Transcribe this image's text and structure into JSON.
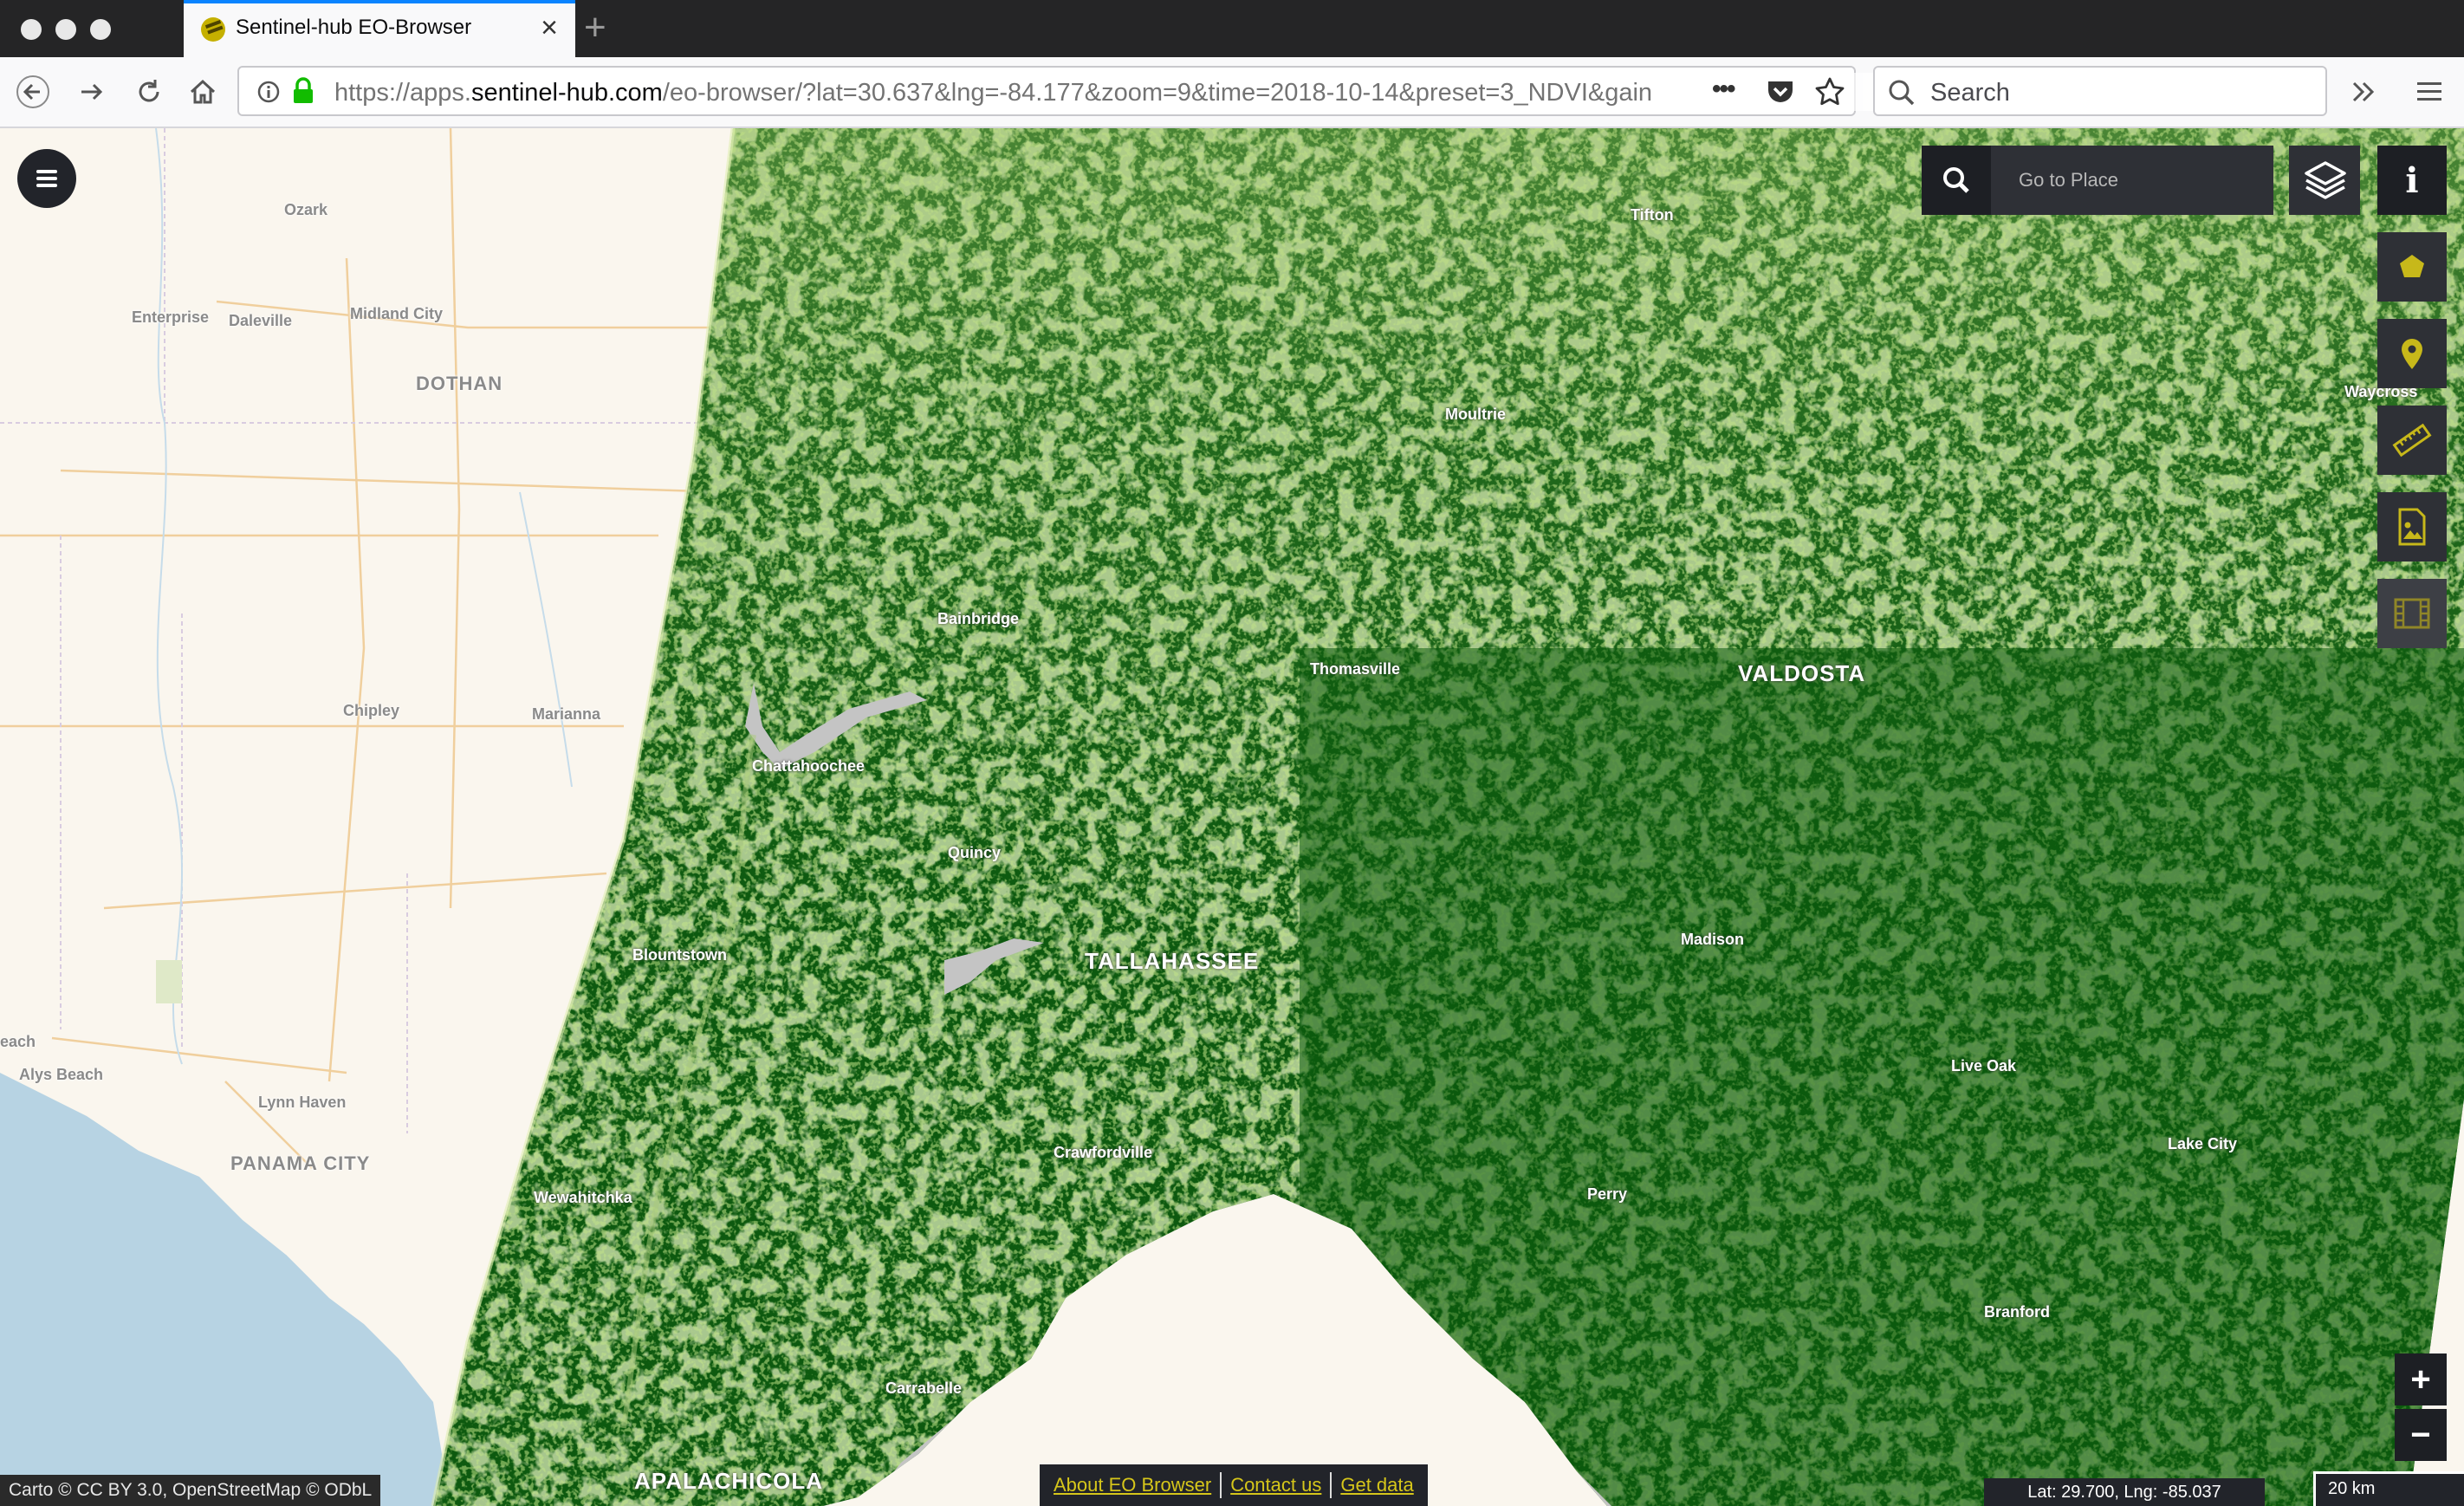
{
  "browser": {
    "tab_title": "Sentinel-hub EO-Browser",
    "new_tab_label": "+",
    "url_prefix": "https://apps.",
    "url_domain": "sentinel-hub.com",
    "url_path": "/eo-browser/?lat=30.637&lng=-84.177&zoom=9&time=2018-10-14&preset=3_NDVI&gain",
    "search_placeholder": "Search",
    "icons": [
      "back-icon",
      "forward-icon",
      "reload-icon",
      "home-icon",
      "info-icon",
      "lock-icon",
      "more-icon",
      "pocket-icon",
      "bookmark-star-icon",
      "search-icon",
      "overflow-icon",
      "hamburger-icon"
    ]
  },
  "app": {
    "goto_placeholder": "Go to Place",
    "info_label": "i",
    "zoom_in_label": "+",
    "zoom_out_label": "−",
    "tools": [
      "polygon-tool-icon",
      "location-pin-icon",
      "measure-ruler-icon",
      "image-export-icon",
      "timelapse-film-icon"
    ],
    "colors": {
      "accent": "#d6c61a",
      "panel": "#2e3036",
      "ndvi_dark": "#0e5a0e",
      "ndvi_light": "#d8e89a",
      "water": "#c4c4c4"
    }
  },
  "map": {
    "basemap_labels": [
      "Ozark",
      "Enterprise",
      "Daleville",
      "Midland City",
      "DOTHAN",
      "Chipley",
      "Marianna",
      "Alys Beach",
      "Lynn Haven",
      "PANAMA CITY",
      "each"
    ],
    "ndvi_labels": [
      "Tifton",
      "Moultrie",
      "Waycross",
      "Bainbridge",
      "Thomasville",
      "VALDOSTA",
      "Chattahoochee",
      "Quincy",
      "TALLAHASSEE",
      "Madison",
      "Blountstown",
      "Live Oak",
      "Lake City",
      "Crawfordville",
      "Perry",
      "Wewahitchka",
      "Branford",
      "Carrabelle",
      "APALACHICOLA"
    ]
  },
  "footer": {
    "attribution": "Carto © CC BY 3.0, OpenStreetMap © ODbL",
    "links": [
      "About EO Browser",
      "Contact us",
      "Get data"
    ],
    "coords": "Lat: 29.700, Lng: -85.037",
    "scale": "20 km"
  }
}
